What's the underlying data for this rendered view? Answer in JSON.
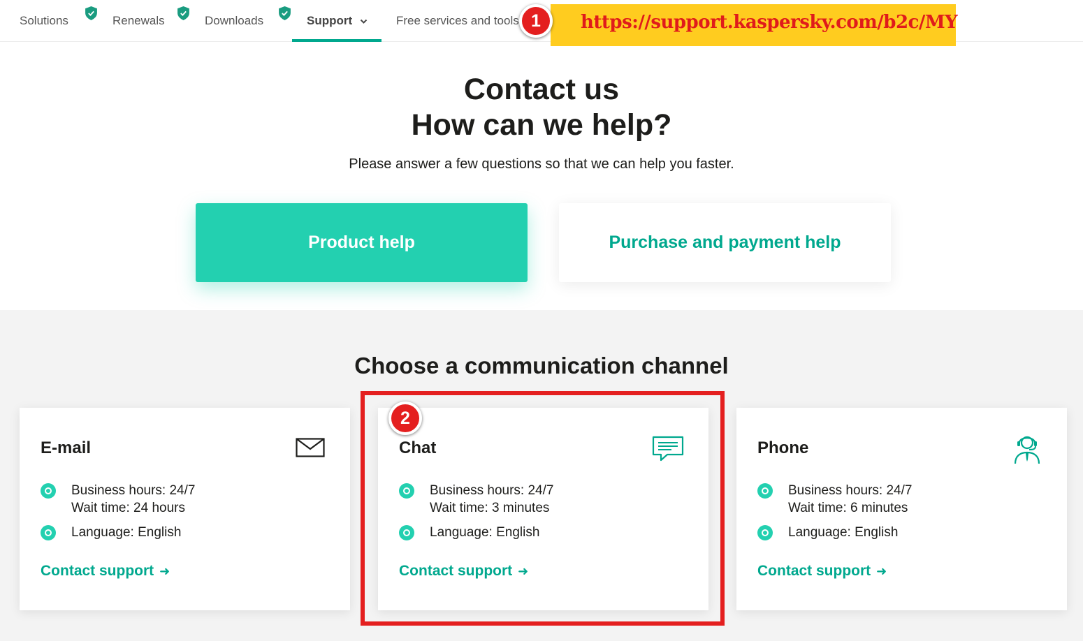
{
  "nav": {
    "items": [
      {
        "label": "Solutions"
      },
      {
        "label": "Renewals"
      },
      {
        "label": "Downloads"
      },
      {
        "label": "Support"
      },
      {
        "label": "Free services and tools"
      }
    ]
  },
  "annotation": {
    "url": "https://support.kaspersky.com/b2c/MY",
    "badge1": "1",
    "badge2": "2"
  },
  "hero": {
    "title_line1": "Contact us",
    "title_line2": "How can we help?",
    "subtitle": "Please answer a few questions so that we can help you faster.",
    "product_help": "Product help",
    "purchase_help": "Purchase and payment help"
  },
  "channels": {
    "title": "Choose a communication channel",
    "cards": [
      {
        "name": "E-mail",
        "hours": "Business hours: 24/7",
        "wait": "Wait time: 24 hours",
        "language": "Language: English",
        "link": "Contact support"
      },
      {
        "name": "Chat",
        "hours": "Business hours: 24/7",
        "wait": "Wait time: 3 minutes",
        "language": "Language: English",
        "link": "Contact support"
      },
      {
        "name": "Phone",
        "hours": "Business hours: 24/7",
        "wait": "Wait time: 6 minutes",
        "language": "Language: English",
        "link": "Contact support"
      }
    ]
  },
  "colors": {
    "accent": "#00a88e",
    "button": "#23d0b0",
    "highlight": "#ffcc1f",
    "annotation_red": "#e41f1f"
  },
  "icons": [
    "shield-check-icon",
    "chevron-down-icon",
    "envelope-icon",
    "chat-icon",
    "headset-icon",
    "arrow-right-icon"
  ]
}
